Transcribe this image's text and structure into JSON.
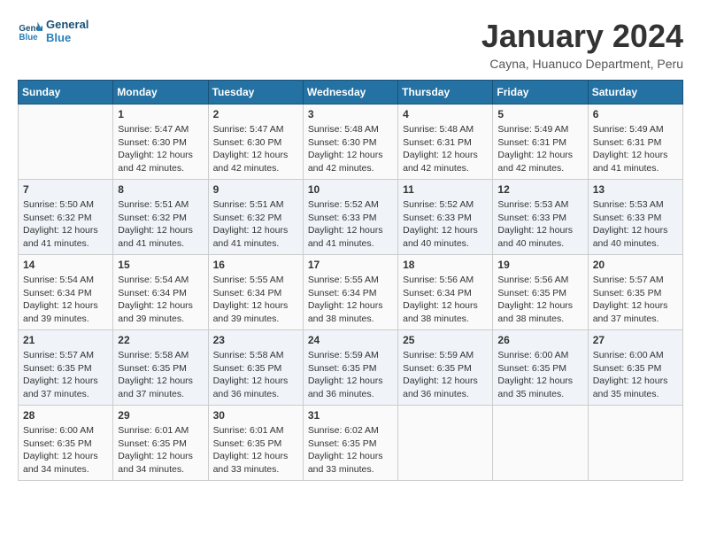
{
  "logo": {
    "text_general": "General",
    "text_blue": "Blue"
  },
  "title": "January 2024",
  "subtitle": "Cayna, Huanuco Department, Peru",
  "headers": [
    "Sunday",
    "Monday",
    "Tuesday",
    "Wednesday",
    "Thursday",
    "Friday",
    "Saturday"
  ],
  "weeks": [
    [
      {
        "day": "",
        "info": ""
      },
      {
        "day": "1",
        "info": "Sunrise: 5:47 AM\nSunset: 6:30 PM\nDaylight: 12 hours\nand 42 minutes."
      },
      {
        "day": "2",
        "info": "Sunrise: 5:47 AM\nSunset: 6:30 PM\nDaylight: 12 hours\nand 42 minutes."
      },
      {
        "day": "3",
        "info": "Sunrise: 5:48 AM\nSunset: 6:30 PM\nDaylight: 12 hours\nand 42 minutes."
      },
      {
        "day": "4",
        "info": "Sunrise: 5:48 AM\nSunset: 6:31 PM\nDaylight: 12 hours\nand 42 minutes."
      },
      {
        "day": "5",
        "info": "Sunrise: 5:49 AM\nSunset: 6:31 PM\nDaylight: 12 hours\nand 42 minutes."
      },
      {
        "day": "6",
        "info": "Sunrise: 5:49 AM\nSunset: 6:31 PM\nDaylight: 12 hours\nand 41 minutes."
      }
    ],
    [
      {
        "day": "7",
        "info": "Sunrise: 5:50 AM\nSunset: 6:32 PM\nDaylight: 12 hours\nand 41 minutes."
      },
      {
        "day": "8",
        "info": "Sunrise: 5:51 AM\nSunset: 6:32 PM\nDaylight: 12 hours\nand 41 minutes."
      },
      {
        "day": "9",
        "info": "Sunrise: 5:51 AM\nSunset: 6:32 PM\nDaylight: 12 hours\nand 41 minutes."
      },
      {
        "day": "10",
        "info": "Sunrise: 5:52 AM\nSunset: 6:33 PM\nDaylight: 12 hours\nand 41 minutes."
      },
      {
        "day": "11",
        "info": "Sunrise: 5:52 AM\nSunset: 6:33 PM\nDaylight: 12 hours\nand 40 minutes."
      },
      {
        "day": "12",
        "info": "Sunrise: 5:53 AM\nSunset: 6:33 PM\nDaylight: 12 hours\nand 40 minutes."
      },
      {
        "day": "13",
        "info": "Sunrise: 5:53 AM\nSunset: 6:33 PM\nDaylight: 12 hours\nand 40 minutes."
      }
    ],
    [
      {
        "day": "14",
        "info": "Sunrise: 5:54 AM\nSunset: 6:34 PM\nDaylight: 12 hours\nand 39 minutes."
      },
      {
        "day": "15",
        "info": "Sunrise: 5:54 AM\nSunset: 6:34 PM\nDaylight: 12 hours\nand 39 minutes."
      },
      {
        "day": "16",
        "info": "Sunrise: 5:55 AM\nSunset: 6:34 PM\nDaylight: 12 hours\nand 39 minutes."
      },
      {
        "day": "17",
        "info": "Sunrise: 5:55 AM\nSunset: 6:34 PM\nDaylight: 12 hours\nand 38 minutes."
      },
      {
        "day": "18",
        "info": "Sunrise: 5:56 AM\nSunset: 6:34 PM\nDaylight: 12 hours\nand 38 minutes."
      },
      {
        "day": "19",
        "info": "Sunrise: 5:56 AM\nSunset: 6:35 PM\nDaylight: 12 hours\nand 38 minutes."
      },
      {
        "day": "20",
        "info": "Sunrise: 5:57 AM\nSunset: 6:35 PM\nDaylight: 12 hours\nand 37 minutes."
      }
    ],
    [
      {
        "day": "21",
        "info": "Sunrise: 5:57 AM\nSunset: 6:35 PM\nDaylight: 12 hours\nand 37 minutes."
      },
      {
        "day": "22",
        "info": "Sunrise: 5:58 AM\nSunset: 6:35 PM\nDaylight: 12 hours\nand 37 minutes."
      },
      {
        "day": "23",
        "info": "Sunrise: 5:58 AM\nSunset: 6:35 PM\nDaylight: 12 hours\nand 36 minutes."
      },
      {
        "day": "24",
        "info": "Sunrise: 5:59 AM\nSunset: 6:35 PM\nDaylight: 12 hours\nand 36 minutes."
      },
      {
        "day": "25",
        "info": "Sunrise: 5:59 AM\nSunset: 6:35 PM\nDaylight: 12 hours\nand 36 minutes."
      },
      {
        "day": "26",
        "info": "Sunrise: 6:00 AM\nSunset: 6:35 PM\nDaylight: 12 hours\nand 35 minutes."
      },
      {
        "day": "27",
        "info": "Sunrise: 6:00 AM\nSunset: 6:35 PM\nDaylight: 12 hours\nand 35 minutes."
      }
    ],
    [
      {
        "day": "28",
        "info": "Sunrise: 6:00 AM\nSunset: 6:35 PM\nDaylight: 12 hours\nand 34 minutes."
      },
      {
        "day": "29",
        "info": "Sunrise: 6:01 AM\nSunset: 6:35 PM\nDaylight: 12 hours\nand 34 minutes."
      },
      {
        "day": "30",
        "info": "Sunrise: 6:01 AM\nSunset: 6:35 PM\nDaylight: 12 hours\nand 33 minutes."
      },
      {
        "day": "31",
        "info": "Sunrise: 6:02 AM\nSunset: 6:35 PM\nDaylight: 12 hours\nand 33 minutes."
      },
      {
        "day": "",
        "info": ""
      },
      {
        "day": "",
        "info": ""
      },
      {
        "day": "",
        "info": ""
      }
    ]
  ]
}
